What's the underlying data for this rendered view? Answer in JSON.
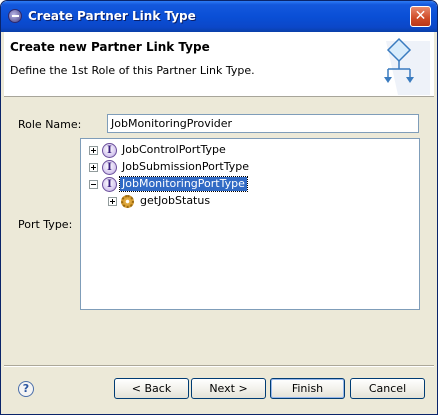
{
  "window": {
    "title": "Create Partner Link Type"
  },
  "banner": {
    "title": "Create new Partner Link Type",
    "subtitle": "Define the 1st Role of this Partner Link Type."
  },
  "form": {
    "role_name_label": "Role Name:",
    "role_name_value": "JobMonitoringProvider",
    "port_type_label": "Port Type:"
  },
  "tree": {
    "items": [
      {
        "label": "JobControlPortType",
        "expander": "plus",
        "icon": "interface-icon",
        "selected": false
      },
      {
        "label": "JobSubmissionPortType",
        "expander": "plus",
        "icon": "interface-icon",
        "selected": false
      },
      {
        "label": "JobMonitoringPortType",
        "expander": "minus",
        "icon": "interface-icon",
        "selected": true
      },
      {
        "label": "getJobStatus",
        "expander": "plus",
        "icon": "operation-icon",
        "selected": false
      }
    ]
  },
  "buttons": {
    "help": "?",
    "back": "< Back",
    "next": "Next >",
    "finish": "Finish",
    "cancel": "Cancel"
  },
  "colors": {
    "titlebar": "#0a4fd6",
    "selection": "#316ac5",
    "dialog_bg": "#ece9d8"
  }
}
